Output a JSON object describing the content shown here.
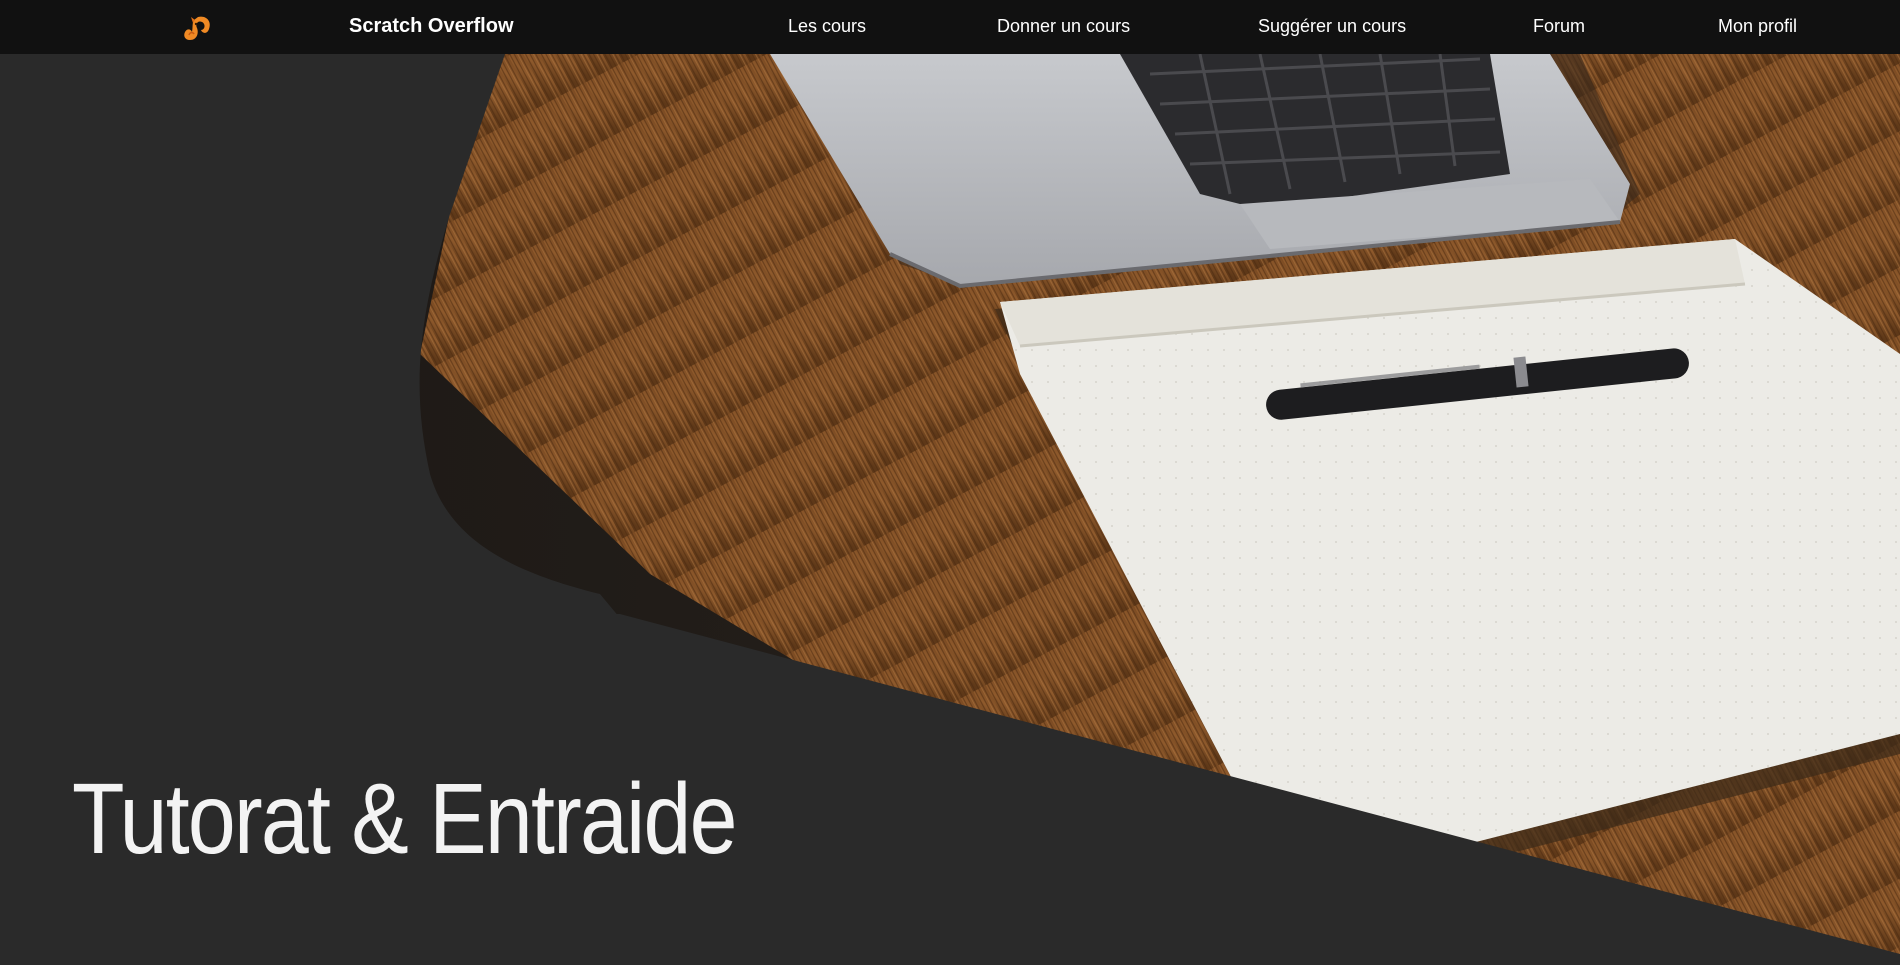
{
  "navbar": {
    "logo_icon": "squirrel-logo-icon",
    "brand": "Scratch Overflow",
    "links": [
      {
        "label": "Les cours"
      },
      {
        "label": "Donner un cours"
      },
      {
        "label": "Suggérer un cours"
      },
      {
        "label": "Forum"
      },
      {
        "label": "Mon profil"
      }
    ]
  },
  "hero": {
    "title": "Tutorat & Entraide",
    "image_subject": "laptop-notebook-pen-on-wooden-desk"
  },
  "colors": {
    "navbar_bg": "#111111",
    "page_bg": "#2a2a2a",
    "accent_orange": "#f08a24",
    "text": "#ffffff"
  }
}
